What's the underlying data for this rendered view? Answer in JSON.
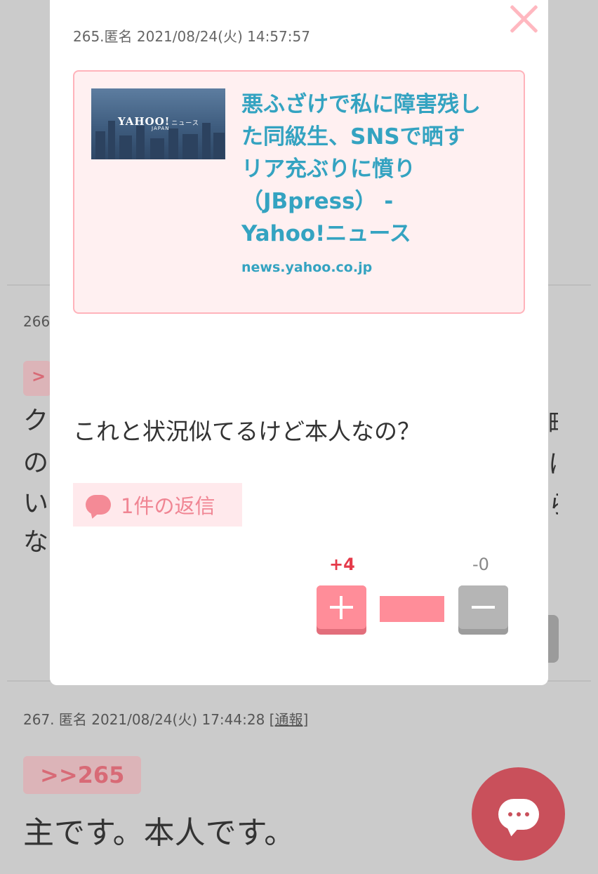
{
  "background": {
    "comment_266_number": "266",
    "comment_266_text_fragments": [
      "ク",
      "の",
      "い",
      "な"
    ],
    "comment_266_anchor_fragment": ">",
    "comment_266_right_chars": [
      "町",
      "に",
      "ら"
    ],
    "comment_267": {
      "meta": "267. 匿名 2021/08/24(火) 17:44:28",
      "report_label": "[通報]",
      "anchor": ">>265",
      "text": "主です。本人です。"
    }
  },
  "modal": {
    "post_meta": "265.匿名 2021/08/24(火) 14:57:57",
    "link_card": {
      "thumbnail_logo": "YAHOO!",
      "thumbnail_logo_sub": "ニュース",
      "thumbnail_logo_japan": "JAPAN",
      "title": "悪ふざけで私に障害残した同級生、SNSで晒すリア充ぶりに憤り（JBpress） - Yahoo!ニュース",
      "domain": "news.yahoo.co.jp"
    },
    "body": "これと状況似てるけど本人なの？",
    "reply_count_label": "1件の返信",
    "votes": {
      "plus_label": "+4",
      "minus_label": "-0",
      "plus_ratio": 1.0
    }
  },
  "icons": {
    "close": "close-icon",
    "reply": "speech-bubble-icon",
    "plus": "plus-icon",
    "minus": "minus-icon",
    "chat": "chat-bubble-icon"
  },
  "colors": {
    "accent": "#ff8d99",
    "link": "#34a3c1",
    "plus_count": "#e53a4a",
    "fab": "#c9505b"
  }
}
